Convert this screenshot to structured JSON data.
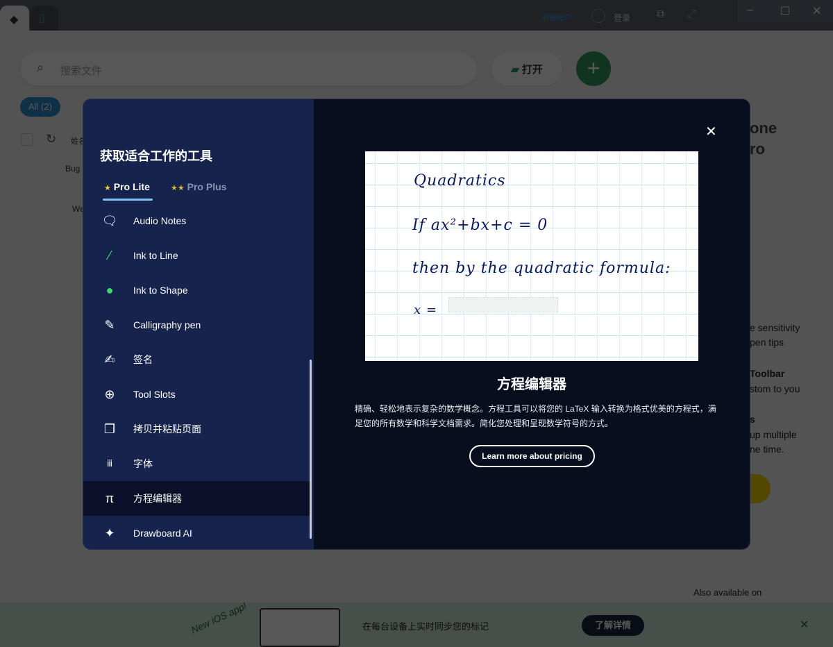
{
  "titlebar": {
    "create_account": "创建帐户",
    "login": "登录"
  },
  "toolbar": {
    "search_placeholder": "搜索文件",
    "open_label": "打开",
    "add_label": "+"
  },
  "filters": {
    "all": "All (2)"
  },
  "list": {
    "header": "姓名",
    "rows": [
      "Bug",
      "We"
    ]
  },
  "side_promo": {
    "title1": "one",
    "title2": "ro",
    "lines": [
      "e sensitivity",
      "pen tips",
      "Toolbar",
      "stom to you",
      "s",
      "up multiple",
      "ne time."
    ],
    "available": "Also available on"
  },
  "banner": {
    "badge": "New iOS app!",
    "text": "在每台设备上实时同步您的标记",
    "button": "了解详情",
    "close": "✕"
  },
  "dialog": {
    "title": "获取适合工作的工具",
    "tabs": [
      {
        "label": "Pro Lite",
        "icon": "★"
      },
      {
        "label": "Pro Plus",
        "icon": "★★"
      }
    ],
    "items": [
      {
        "label": "Audio Notes",
        "icon": "audio-notes-icon"
      },
      {
        "label": "Ink to Line",
        "icon": "ink-line-icon"
      },
      {
        "label": "Ink to Shape",
        "icon": "ink-shape-icon"
      },
      {
        "label": "Calligraphy pen",
        "icon": "pen-icon"
      },
      {
        "label": "签名",
        "icon": "signature-icon"
      },
      {
        "label": "Tool Slots",
        "icon": "plus-circle-icon"
      },
      {
        "label": "拷贝并粘贴页面",
        "icon": "copy-page-icon"
      },
      {
        "label": "字体",
        "icon": "font-icon"
      },
      {
        "label": "方程编辑器",
        "icon": "pi-icon",
        "selected": true
      },
      {
        "label": "Drawboard AI",
        "icon": "sparkle-icon"
      }
    ],
    "preview": {
      "line1": "Quadratics",
      "line2": "If ax²+bx+c = 0",
      "line3": "then by the quadratic formula:",
      "line4": "x ="
    },
    "feature_title": "方程编辑器",
    "description": "精确、轻松地表示复杂的数学概念。方程工具可以将您的 LaTeX 输入转换为格式优美的方程式，满足您的所有数学和科学文档需求。简化您处理和呈现数学符号的方式。",
    "learn_more": "Learn more about pricing",
    "close": "✕"
  }
}
